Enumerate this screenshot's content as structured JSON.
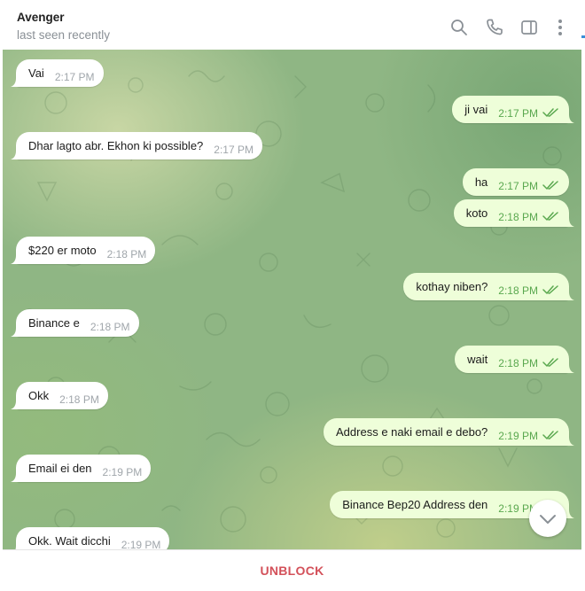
{
  "header": {
    "title": "Avenger",
    "status": "last seen recently",
    "icons": [
      "search-icon",
      "phone-icon",
      "sidebar-toggle-icon",
      "more-vertical-icon"
    ]
  },
  "messages": [
    {
      "dir": "in",
      "text": "Vai",
      "time": "2:17 PM"
    },
    {
      "dir": "out",
      "text": "ji vai",
      "time": "2:17 PM",
      "read": true
    },
    {
      "dir": "in",
      "text": "Dhar lagto abr. Ekhon ki possible?",
      "time": "2:17 PM"
    },
    {
      "dir": "out",
      "text": "ha",
      "time": "2:17 PM",
      "read": true
    },
    {
      "dir": "out",
      "text": "koto",
      "time": "2:18 PM",
      "read": true
    },
    {
      "dir": "in",
      "text": "$220 er moto",
      "time": "2:18 PM"
    },
    {
      "dir": "out",
      "text": "kothay niben?",
      "time": "2:18 PM",
      "read": true
    },
    {
      "dir": "in",
      "text": "Binance e",
      "time": "2:18 PM"
    },
    {
      "dir": "out",
      "text": "wait",
      "time": "2:18 PM",
      "read": true
    },
    {
      "dir": "in",
      "text": "Okk",
      "time": "2:18 PM"
    },
    {
      "dir": "out",
      "text": "Address e naki email e debo?",
      "time": "2:19 PM",
      "read": true
    },
    {
      "dir": "in",
      "text": "Email ei den",
      "time": "2:19 PM"
    },
    {
      "dir": "out",
      "text": "Binance Bep20 Address den",
      "time": "2:19 PM",
      "read": true
    },
    {
      "dir": "in",
      "text": "Okk. Wait dicchi",
      "time": "2:19 PM"
    }
  ],
  "footer": {
    "unblock_label": "UNBLOCK"
  },
  "colors": {
    "accent_red": "#d3515a",
    "outgoing_bubble": "#eefed9",
    "check_green": "#5aa84f"
  }
}
